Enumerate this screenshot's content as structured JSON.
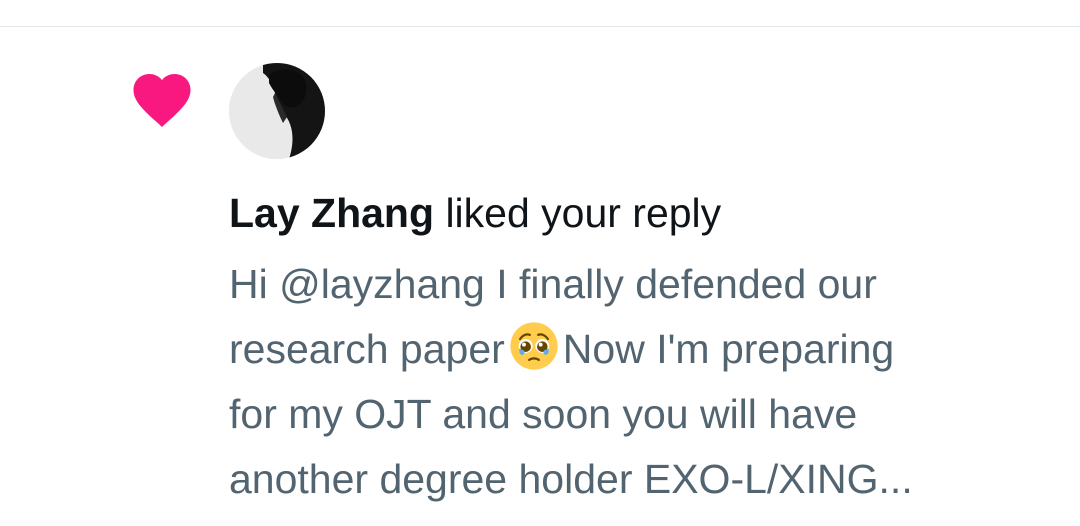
{
  "notification": {
    "type_icon": "heart-icon",
    "type_color": "#f91880",
    "avatar": "user-avatar",
    "user_name": "Lay Zhang",
    "action_text": "liked your reply",
    "reply_lines": {
      "line1": "Hi @layzhang I finally defended our",
      "line2_before": "research paper",
      "line2_emoji": "pleading-face-emoji",
      "line2_after": "Now I'm preparing",
      "line3": "for my OJT and soon you will have",
      "line4": "another degree holder EXO-L/XING..."
    },
    "text_colors": {
      "primary": "#0f1419",
      "secondary": "#536471"
    }
  }
}
